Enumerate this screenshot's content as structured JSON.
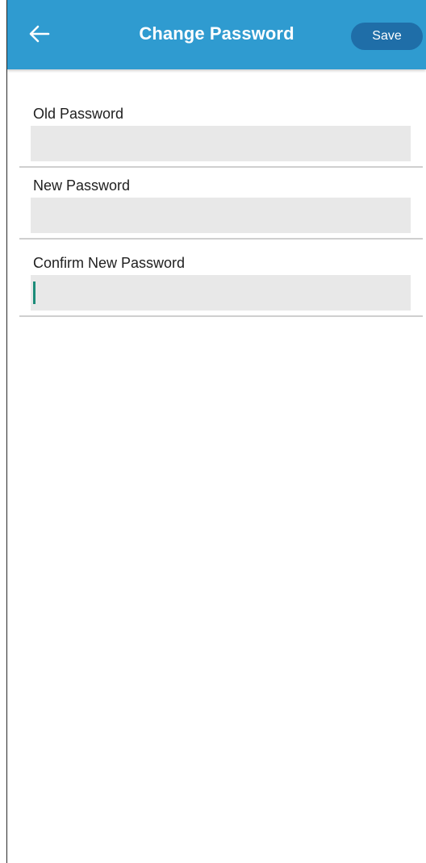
{
  "appbar": {
    "title": "Change Password",
    "save_label": "Save",
    "back_icon": "arrow-left-icon",
    "background_color": "#2f9bd0",
    "save_color": "#1f6ea8"
  },
  "form": {
    "fields": [
      {
        "label": "Old Password",
        "value": "",
        "placeholder": ""
      },
      {
        "label": "New Password",
        "value": "",
        "placeholder": ""
      },
      {
        "label": "Confirm New Password",
        "value": "",
        "placeholder": ""
      }
    ],
    "field_bg_color": "#e8e8e8",
    "caret_color": "#1c8c79"
  }
}
